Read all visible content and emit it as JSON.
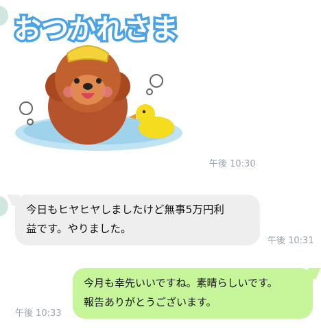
{
  "chat": {
    "sticker": {
      "text": "おつかれさま",
      "time": "午後 10:30"
    },
    "received_message": {
      "line1": "今日もヒヤヒヤしましたけど無事5万円利",
      "line2": "益です。やりました。",
      "time": "午後 10:31"
    },
    "sent_message": {
      "line1": "今月も幸先いいですね。素晴らしいです。",
      "line2": "報告ありがとうございます。",
      "time": "午後 10:33"
    }
  },
  "colors": {
    "incoming_bubble": "#eeeeee",
    "outgoing_bubble": "#c6f59a",
    "timestamp": "#9aa3ad",
    "sticker_text": "#4aa3e8"
  },
  "icons": {
    "sticker": "dog-in-bath-with-duck-sticker",
    "avatar": "contact-avatar"
  }
}
